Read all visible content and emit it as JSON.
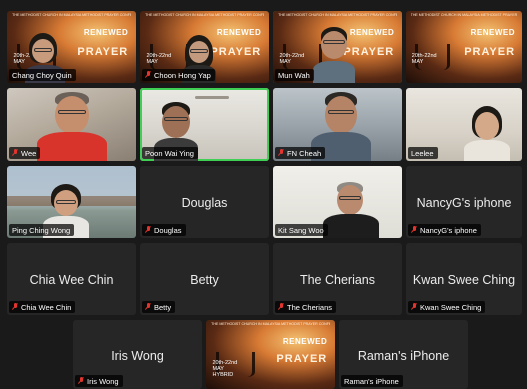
{
  "meeting": {
    "poster": {
      "header": "THE METHODIST CHURCH IN MALAYSIA   METHODIST PRAYER CONFERENCE",
      "title_line1": "RENEWED",
      "title_line2": "Through",
      "title_line3": "PRAYER",
      "date_line1": "20th-22nd",
      "date_line2": "MAY",
      "date_line3": "HYBRID"
    },
    "participants": [
      {
        "name": "Chang Choy Quin",
        "muted": false,
        "video": "poster"
      },
      {
        "name": "Choon Hong Yap",
        "muted": true,
        "video": "poster"
      },
      {
        "name": "Mun Wah",
        "muted": false,
        "video": "poster",
        "speaking": true
      },
      {
        "name": "",
        "muted": false,
        "video": "poster"
      },
      {
        "name": "Wee",
        "muted": true,
        "video": "camera"
      },
      {
        "name": "Poon Wai Ying",
        "muted": false,
        "video": "camera",
        "speaking": true
      },
      {
        "name": "FN Cheah",
        "muted": true,
        "video": "camera"
      },
      {
        "name": "Leelee",
        "muted": false,
        "video": "camera"
      },
      {
        "name": "Ping Ching Wong",
        "muted": false,
        "video": "camera"
      },
      {
        "name": "Douglas",
        "muted": true,
        "video": "off"
      },
      {
        "name": "Kit Sang Woo",
        "muted": false,
        "video": "camera"
      },
      {
        "name": "NancyG's iphone",
        "muted": true,
        "video": "off"
      },
      {
        "name": "Chia Wee Chin",
        "muted": true,
        "video": "off"
      },
      {
        "name": "Betty",
        "muted": true,
        "video": "off"
      },
      {
        "name": "The Cherians",
        "muted": true,
        "video": "off"
      },
      {
        "name": "Kwan Swee Ching",
        "muted": true,
        "video": "off"
      },
      {
        "name": "Iris Wong",
        "muted": true,
        "video": "off"
      },
      {
        "name": "",
        "muted": false,
        "video": "poster"
      },
      {
        "name": "Raman's iPhone",
        "muted": false,
        "video": "off"
      }
    ]
  },
  "colors": {
    "background": "#1a1a1a",
    "tile": "#262626",
    "active_speaker_border": "#3fcf55",
    "muted_icon": "#e3352e"
  }
}
